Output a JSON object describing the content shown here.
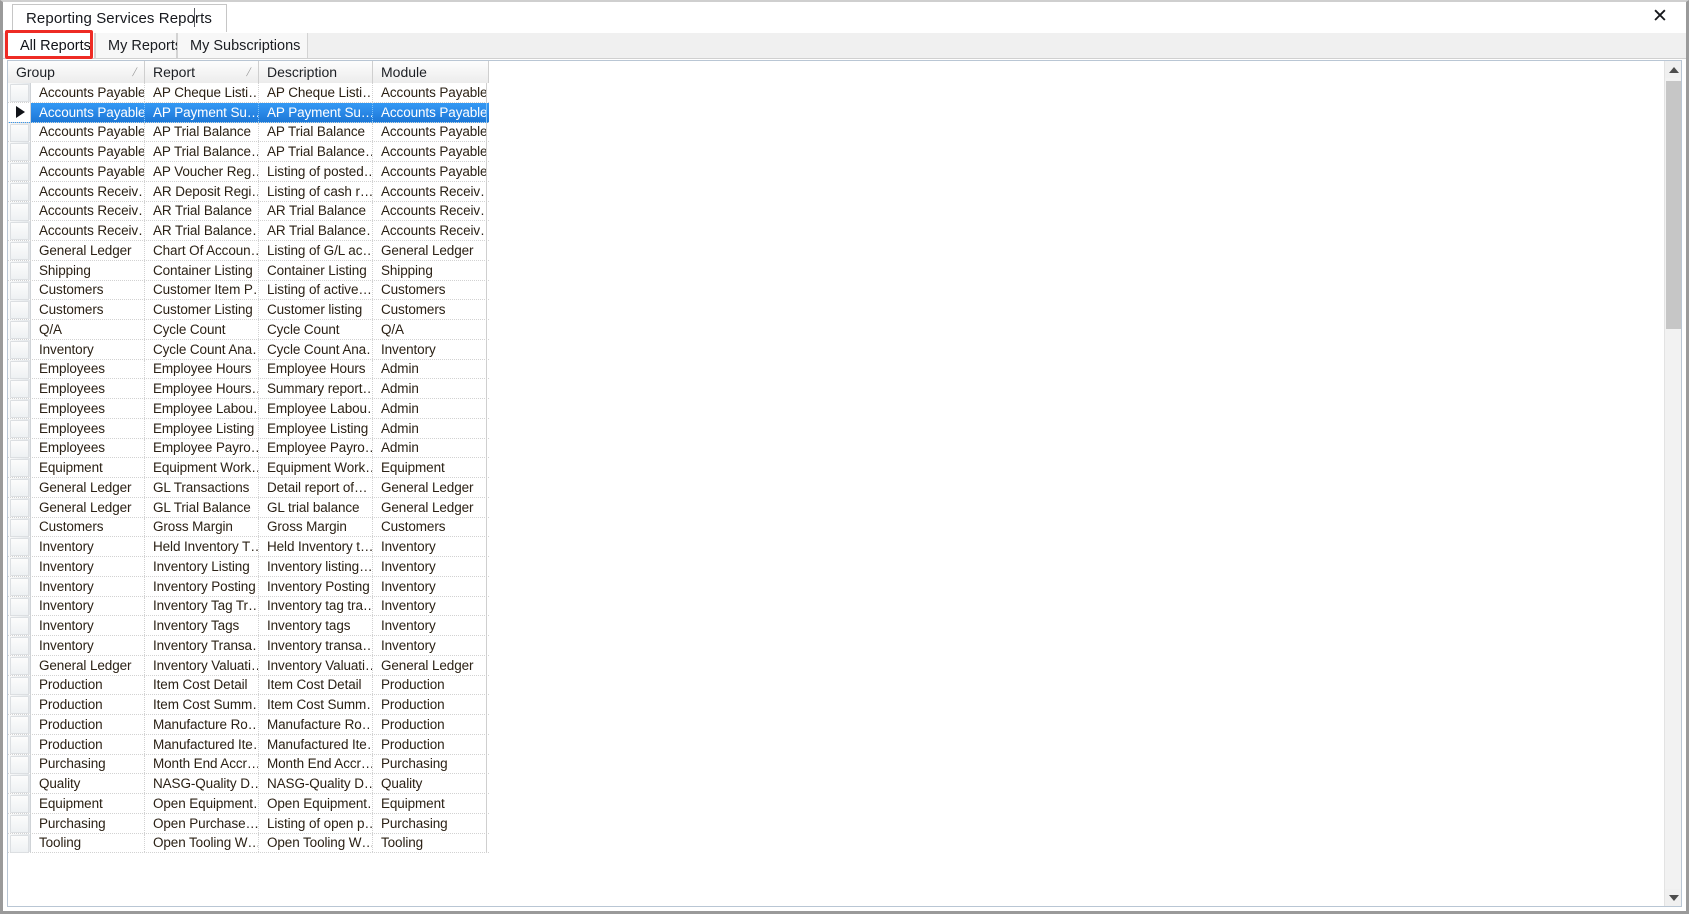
{
  "window": {
    "document_tab": "Reporting Services Reports",
    "close_label": "✕",
    "close_icon": "close-icon"
  },
  "tabs": [
    {
      "label": "All Reports",
      "active": true
    },
    {
      "label": "My Reports",
      "active": false
    },
    {
      "label": "My Subscriptions",
      "active": false
    }
  ],
  "grid": {
    "columns": [
      {
        "label": "Group",
        "sort_indicator": "/"
      },
      {
        "label": "Report",
        "sort_indicator": "/"
      },
      {
        "label": "Description",
        "sort_indicator": ""
      },
      {
        "label": "Module",
        "sort_indicator": ""
      }
    ],
    "selected_row_index": 1,
    "row_indicator_glyph": "▶",
    "rows": [
      {
        "group": "Accounts Payable",
        "report": "AP Cheque Listi…",
        "description": "AP Cheque Listi…",
        "module": "Accounts Payable"
      },
      {
        "group": "Accounts Payable",
        "report": "AP Payment Su…",
        "description": "AP Payment Su…",
        "module": "Accounts Payable"
      },
      {
        "group": "Accounts Payable",
        "report": "AP Trial Balance",
        "description": "AP Trial Balance",
        "module": "Accounts Payable"
      },
      {
        "group": "Accounts Payable",
        "report": "AP Trial Balance…",
        "description": "AP Trial Balance…",
        "module": "Accounts Payable"
      },
      {
        "group": "Accounts Payable",
        "report": "AP Voucher Reg…",
        "description": "Listing of posted…",
        "module": "Accounts Payable"
      },
      {
        "group": "Accounts Receiv…",
        "report": "AR Deposit Regi…",
        "description": "Listing of cash r…",
        "module": "Accounts Receiv…"
      },
      {
        "group": "Accounts Receiv…",
        "report": "AR Trial Balance",
        "description": "AR Trial Balance",
        "module": "Accounts Receiv…"
      },
      {
        "group": "Accounts Receiv…",
        "report": "AR Trial Balance…",
        "description": "AR Trial Balance…",
        "module": "Accounts Receiv…"
      },
      {
        "group": "General Ledger",
        "report": "Chart Of Accoun…",
        "description": "Listing of G/L ac…",
        "module": "General Ledger"
      },
      {
        "group": "Shipping",
        "report": "Container Listing",
        "description": "Container Listing",
        "module": "Shipping"
      },
      {
        "group": "Customers",
        "report": "Customer Item P…",
        "description": "Listing of active…",
        "module": "Customers"
      },
      {
        "group": "Customers",
        "report": "Customer Listing",
        "description": "Customer listing",
        "module": "Customers"
      },
      {
        "group": "Q/A",
        "report": "Cycle Count",
        "description": "Cycle Count",
        "module": "Q/A"
      },
      {
        "group": "Inventory",
        "report": "Cycle Count Ana…",
        "description": "Cycle Count Ana…",
        "module": "Inventory"
      },
      {
        "group": "Employees",
        "report": "Employee Hours",
        "description": "Employee Hours",
        "module": "Admin"
      },
      {
        "group": "Employees",
        "report": "Employee Hours…",
        "description": "Summary report…",
        "module": "Admin"
      },
      {
        "group": "Employees",
        "report": "Employee Labou…",
        "description": "Employee Labou…",
        "module": "Admin"
      },
      {
        "group": "Employees",
        "report": "Employee Listing",
        "description": "Employee Listing",
        "module": "Admin"
      },
      {
        "group": "Employees",
        "report": "Employee Payro…",
        "description": "Employee Payro…",
        "module": "Admin"
      },
      {
        "group": "Equipment",
        "report": "Equipment Work…",
        "description": "Equipment Work…",
        "module": "Equipment"
      },
      {
        "group": "General Ledger",
        "report": "GL Transactions",
        "description": "Detail report of…",
        "module": "General Ledger"
      },
      {
        "group": "General Ledger",
        "report": "GL Trial Balance",
        "description": "GL trial balance",
        "module": "General Ledger"
      },
      {
        "group": "Customers",
        "report": "Gross Margin",
        "description": "Gross Margin",
        "module": "Customers"
      },
      {
        "group": "Inventory",
        "report": "Held Inventory T…",
        "description": "Held Inventory t…",
        "module": "Inventory"
      },
      {
        "group": "Inventory",
        "report": "Inventory Listing",
        "description": "Inventory listing…",
        "module": "Inventory"
      },
      {
        "group": "Inventory",
        "report": "Inventory Posting",
        "description": "Inventory Posting",
        "module": "Inventory"
      },
      {
        "group": "Inventory",
        "report": "Inventory Tag Tr…",
        "description": "Inventory tag tra…",
        "module": "Inventory"
      },
      {
        "group": "Inventory",
        "report": "Inventory Tags",
        "description": "Inventory tags",
        "module": "Inventory"
      },
      {
        "group": "Inventory",
        "report": "Inventory Transa…",
        "description": "Inventory transa…",
        "module": "Inventory"
      },
      {
        "group": "General Ledger",
        "report": "Inventory Valuati…",
        "description": "Inventory Valuati…",
        "module": "General Ledger"
      },
      {
        "group": "Production",
        "report": "Item Cost Detail",
        "description": "Item Cost Detail",
        "module": "Production"
      },
      {
        "group": "Production",
        "report": "Item Cost Summ…",
        "description": "Item Cost Summ…",
        "module": "Production"
      },
      {
        "group": "Production",
        "report": "Manufacture Ro…",
        "description": "Manufacture Ro…",
        "module": "Production"
      },
      {
        "group": "Production",
        "report": "Manufactured Ite…",
        "description": "Manufactured Ite…",
        "module": "Production"
      },
      {
        "group": "Purchasing",
        "report": "Month End Accr…",
        "description": "Month End Accr…",
        "module": "Purchasing"
      },
      {
        "group": "Quality",
        "report": "NASG-Quality D…",
        "description": "NASG-Quality D…",
        "module": "Quality"
      },
      {
        "group": "Equipment",
        "report": "Open Equipment…",
        "description": "Open Equipment…",
        "module": "Equipment"
      },
      {
        "group": "Purchasing",
        "report": "Open Purchase…",
        "description": "Listing of open p…",
        "module": "Purchasing"
      },
      {
        "group": "Tooling",
        "report": "Open Tooling W…",
        "description": "Open Tooling W…",
        "module": "Tooling"
      }
    ]
  },
  "scrollbar": {
    "up_arrow_icon": "chevron-up-icon",
    "down_arrow_icon": "chevron-down-icon"
  },
  "colors": {
    "selection_blue": "#2b8ae8",
    "highlight_red": "#ee2b24",
    "text": "#2b2115"
  }
}
